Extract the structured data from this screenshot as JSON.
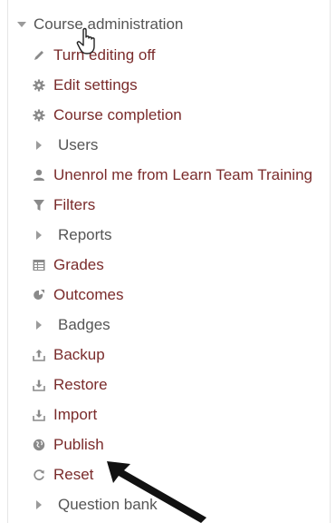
{
  "nav": {
    "section_title": "Course administration",
    "items": [
      {
        "label": "Turn editing off",
        "icon": "pencil-icon"
      },
      {
        "label": "Edit settings",
        "icon": "gear-icon"
      },
      {
        "label": "Course completion",
        "icon": "gear-icon"
      },
      {
        "label": "Users",
        "icon": "expand-arrow-icon"
      },
      {
        "label": "Unenrol me from Learn Team Training",
        "icon": "user-icon"
      },
      {
        "label": "Filters",
        "icon": "filter-icon"
      },
      {
        "label": "Reports",
        "icon": "expand-arrow-icon"
      },
      {
        "label": "Grades",
        "icon": "grades-table-icon"
      },
      {
        "label": "Outcomes",
        "icon": "outcomes-icon"
      },
      {
        "label": "Badges",
        "icon": "expand-arrow-icon"
      },
      {
        "label": "Backup",
        "icon": "backup-icon"
      },
      {
        "label": "Restore",
        "icon": "restore-icon"
      },
      {
        "label": "Import",
        "icon": "import-icon"
      },
      {
        "label": "Publish",
        "icon": "globe-icon"
      },
      {
        "label": "Reset",
        "icon": "reset-icon"
      },
      {
        "label": "Question bank",
        "icon": "expand-arrow-icon"
      }
    ]
  },
  "colors": {
    "link": "#7a2b2b",
    "node_text": "#555555",
    "icon": "#8a8a8a",
    "annotation_arrow": "#111111"
  }
}
